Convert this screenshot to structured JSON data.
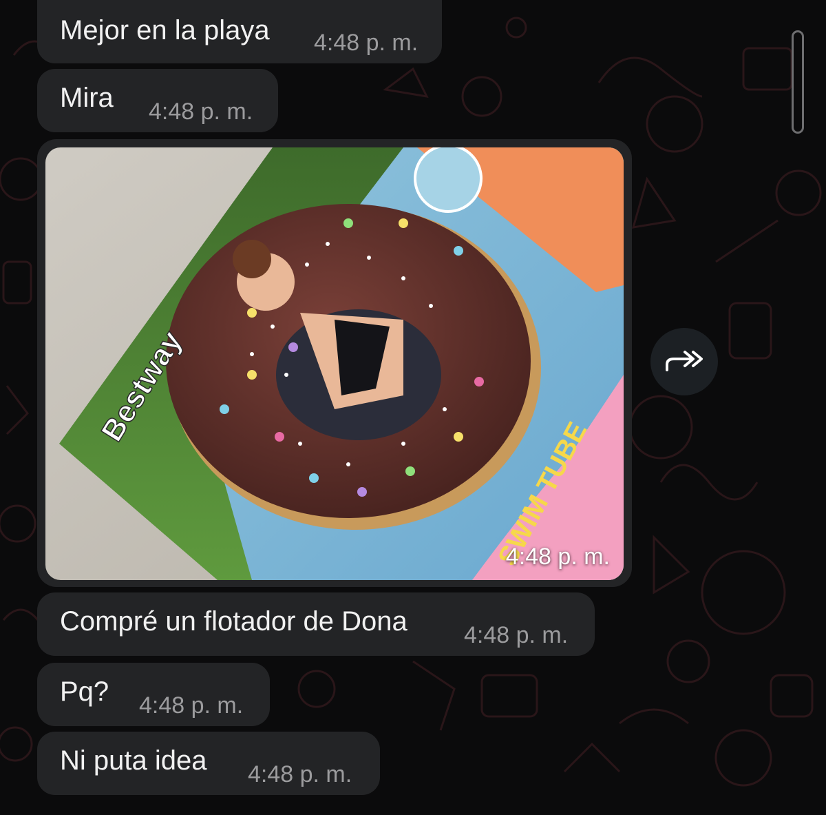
{
  "messages": [
    {
      "text": "Mejor en la playa",
      "time": "4:48 p. m."
    },
    {
      "text": "Mira",
      "time": "4:48 p. m."
    },
    {
      "image": {
        "time": "4:48 p. m.",
        "brand_text": "Bestway",
        "banner_text": "SWIM TUBE"
      }
    },
    {
      "text": "Compré un flotador de Dona",
      "time": "4:48 p. m."
    },
    {
      "text": "Pq?",
      "time": "4:48 p. m."
    },
    {
      "text": "Ni puta idea",
      "time": "4:48 p. m."
    }
  ],
  "icons": {
    "forward": "forward-icon",
    "scrollbar": "scrollbar"
  },
  "colors": {
    "background": "#0b0b0c",
    "bubble": "#232426",
    "text": "#f1f1f1",
    "timestamp": "#9c9c9e",
    "wallpaper_doodle": "#2a1619"
  }
}
